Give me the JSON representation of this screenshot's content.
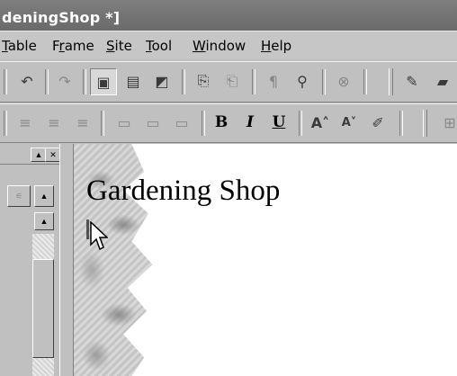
{
  "window": {
    "title": "deningShop *]"
  },
  "menu": [
    {
      "label": "Table",
      "key": "T"
    },
    {
      "label": "Frame",
      "key": "r"
    },
    {
      "label": "Site",
      "key": "S"
    },
    {
      "label": "Tool",
      "key": "T"
    },
    {
      "label": "Window",
      "key": "W"
    },
    {
      "label": "Help",
      "key": "H"
    }
  ],
  "format_toolbar": {
    "bold": "B",
    "italic": "I",
    "underline": "U"
  },
  "document": {
    "heading": "Gardening Shop"
  }
}
